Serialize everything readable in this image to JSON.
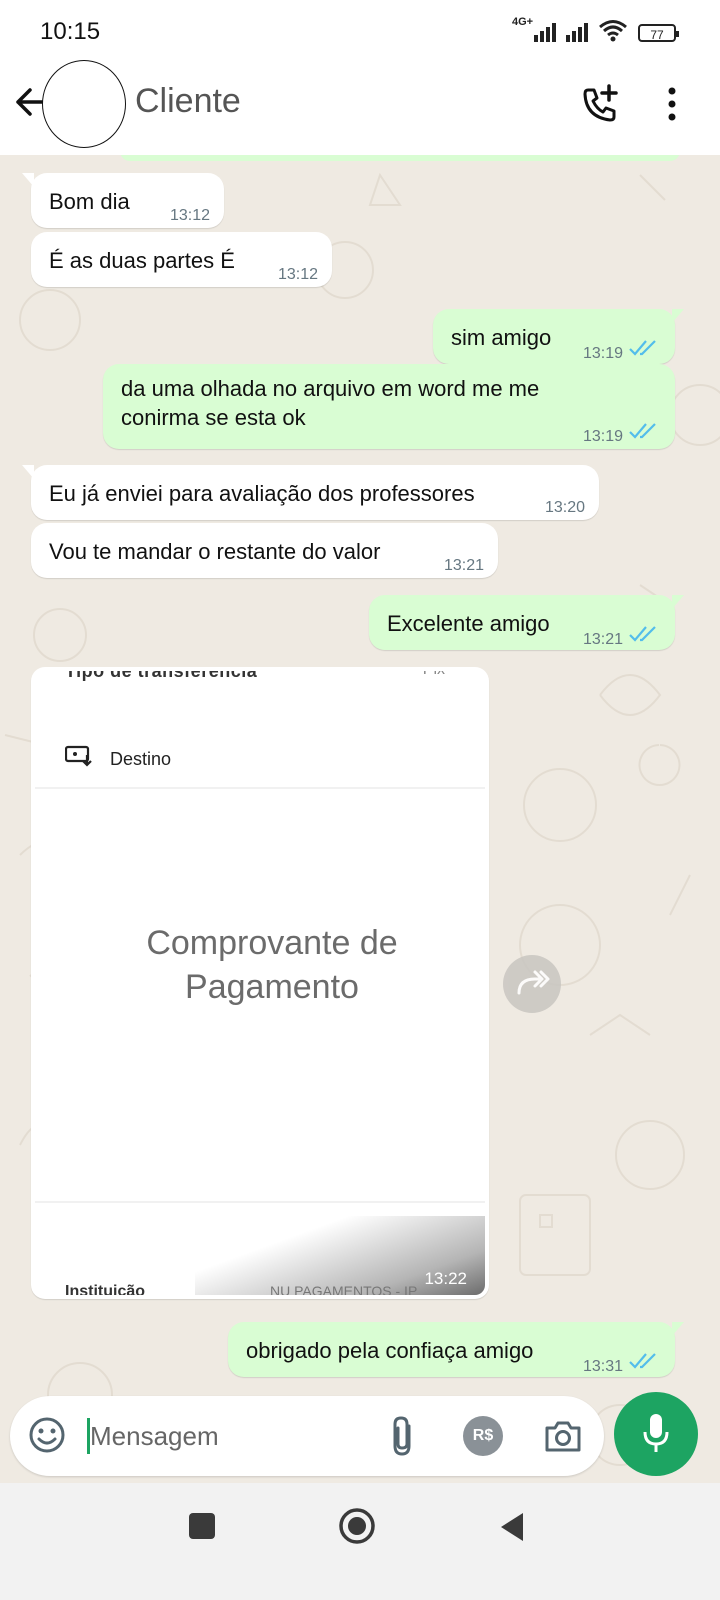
{
  "status_bar": {
    "time": "10:15",
    "network_label": "4G+",
    "battery": "77"
  },
  "header": {
    "contact_name": "Cliente"
  },
  "messages": [
    {
      "direction": "in",
      "text": "Bom dia",
      "time": "13:12"
    },
    {
      "direction": "in",
      "text": "É as duas partes É",
      "time": "13:12"
    },
    {
      "direction": "out",
      "text": "sim amigo",
      "time": "13:19",
      "status": "read"
    },
    {
      "direction": "out",
      "text_line1": "da uma olhada no arquivo em word me me",
      "text_line2": "conirma se esta ok",
      "time": "13:19",
      "status": "read"
    },
    {
      "direction": "in",
      "text": "Eu já enviei para avaliação dos professores",
      "time": "13:20"
    },
    {
      "direction": "in",
      "text": "Vou te mandar o restante do valor",
      "time": "13:21"
    },
    {
      "direction": "out",
      "text": "Excelente amigo",
      "time": "13:21",
      "status": "read"
    },
    {
      "direction": "in",
      "type": "image",
      "time": "13:22",
      "image": {
        "top_cut_text": "Tipo de transferência",
        "top_cut_value": "Pix",
        "destination_label": "Destino",
        "caption_line1": "Comprovante de",
        "caption_line2": "Pagamento",
        "bottom_cut_text": "Instituição",
        "bottom_cut_value": "NU PAGAMENTOS - IP"
      }
    },
    {
      "direction": "out",
      "text": "obrigado pela confiaça amigo",
      "time": "13:31",
      "status": "read"
    }
  ],
  "composer": {
    "placeholder": "Mensagem",
    "payment_label": "R$"
  },
  "colors": {
    "outgoing_bubble": "#d9fdd3",
    "incoming_bubble": "#ffffff",
    "chat_background": "#efeae2",
    "accent_green": "#1da462",
    "read_ticks": "#53bdeb"
  }
}
